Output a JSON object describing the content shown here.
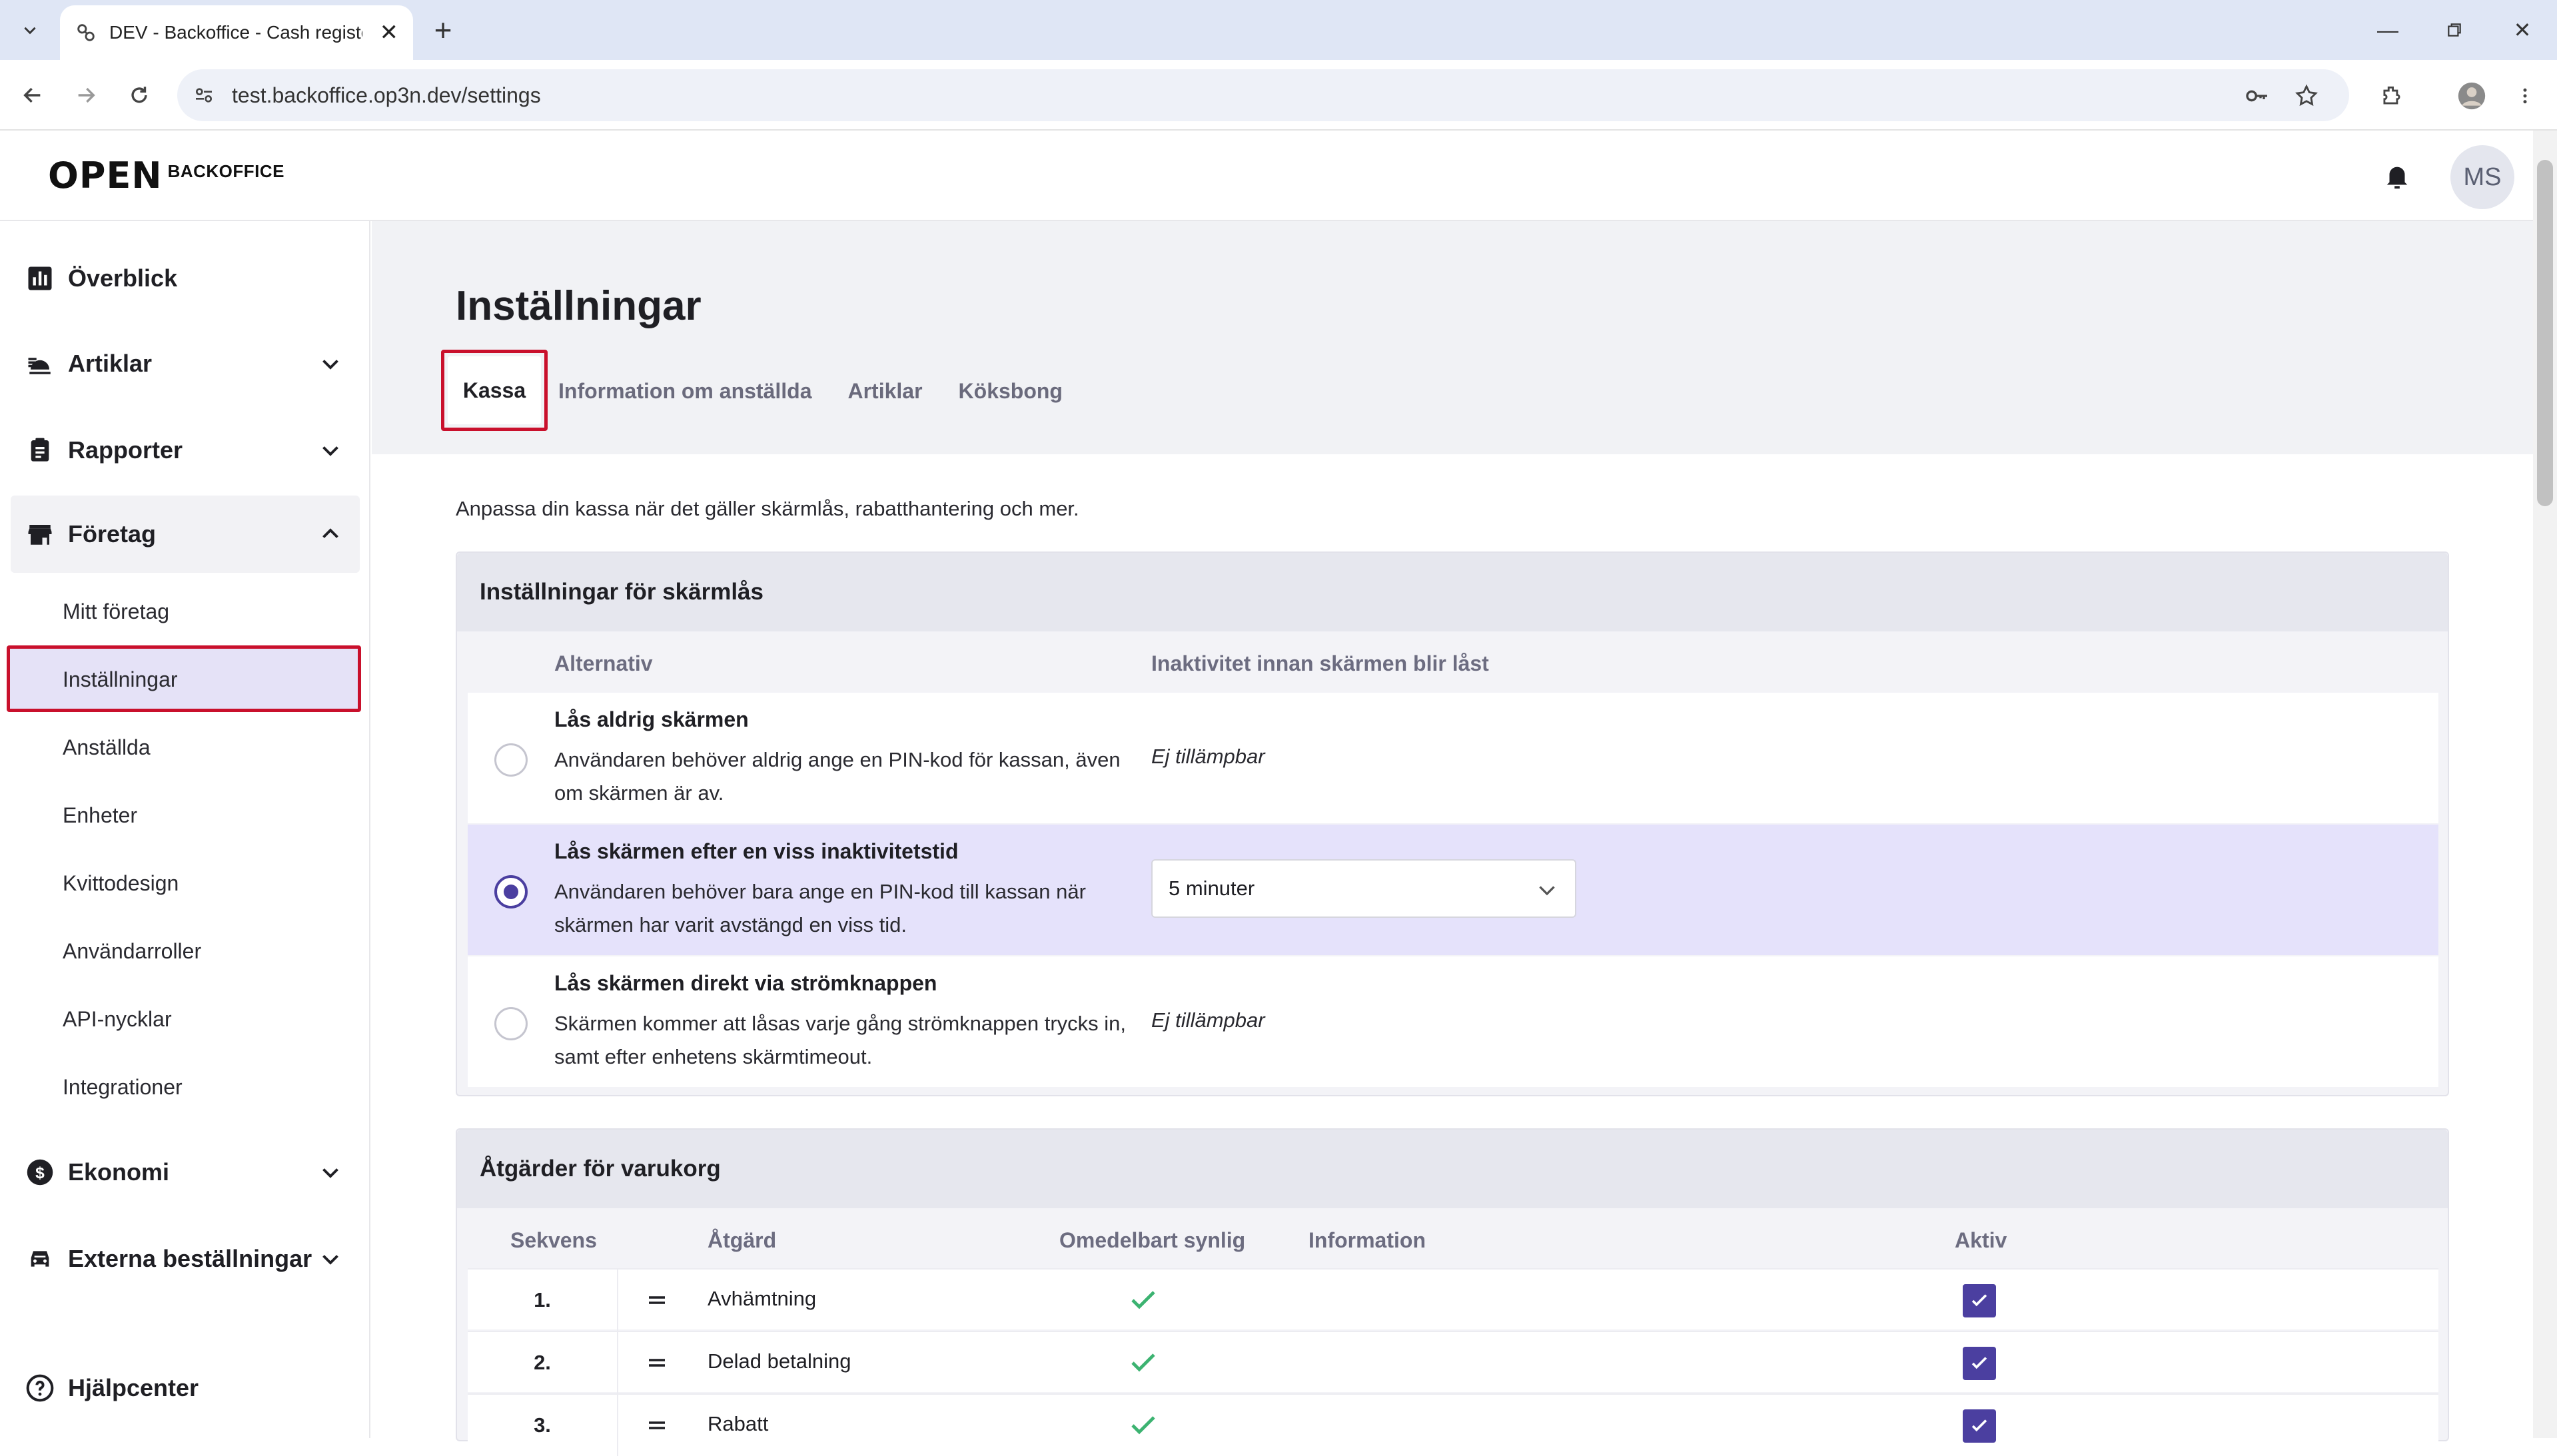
{
  "browser": {
    "tab_title": "DEV - Backoffice - Cash register",
    "url": "test.backoffice.op3n.dev/settings"
  },
  "app": {
    "logo_mark": "OPEN",
    "logo_text": "BACKOFFICE",
    "avatar_initials": "MS"
  },
  "sidebar": {
    "items": [
      {
        "label": "Överblick",
        "icon": "bar-chart-icon"
      },
      {
        "label": "Artiklar",
        "icon": "food-icon"
      },
      {
        "label": "Rapporter",
        "icon": "clipboard-icon"
      },
      {
        "label": "Företag",
        "icon": "store-icon"
      },
      {
        "label": "Ekonomi",
        "icon": "dollar-icon"
      },
      {
        "label": "Externa beställningar",
        "icon": "car-icon"
      },
      {
        "label": "Hjälpcenter",
        "icon": "help-icon"
      }
    ],
    "company_sub": [
      "Mitt företag",
      "Inställningar",
      "Anställda",
      "Enheter",
      "Kvittodesign",
      "Användarroller",
      "API-nycklar",
      "Integrationer"
    ],
    "active_sub": "Inställningar"
  },
  "page": {
    "title": "Inställningar",
    "tabs": [
      "Kassa",
      "Information om anställda",
      "Artiklar",
      "Köksbong"
    ],
    "active_tab": "Kassa",
    "intro": "Anpassa din kassa när det gäller skärmlås, rabatthantering och mer."
  },
  "screen_lock": {
    "heading": "Inställningar för skärmlås",
    "col_option": "Alternativ",
    "col_inactivity": "Inaktivitet innan skärmen blir låst",
    "options": [
      {
        "title": "Lås aldrig skärmen",
        "desc": "Användaren behöver aldrig ange en PIN-kod för kassan, även om skärmen är av.",
        "value": "Ej tillämpbar"
      },
      {
        "title": "Lås skärmen efter en viss inaktivitetstid",
        "desc": "Användaren behöver bara ange en PIN-kod till kassan när skärmen har varit avstängd en viss tid.",
        "value": "5 minuter"
      },
      {
        "title": "Lås skärmen direkt via strömknappen",
        "desc": "Skärmen kommer att låsas varje gång strömknappen trycks in, samt efter enhetens skärmtimeout.",
        "value": "Ej tillämpbar"
      }
    ],
    "selected_index": 1
  },
  "cart_actions": {
    "heading": "Åtgärder för varukorg",
    "columns": [
      "Sekvens",
      "Åtgärd",
      "Omedelbart synlig",
      "Information",
      "Aktiv"
    ],
    "rows": [
      {
        "seq": "1.",
        "action": "Avhämtning",
        "visible": true,
        "active": true
      },
      {
        "seq": "2.",
        "action": "Delad betalning",
        "visible": true,
        "active": true
      },
      {
        "seq": "3.",
        "action": "Rabatt",
        "visible": true,
        "active": true
      }
    ]
  },
  "colors": {
    "accent": "#4b3fa0",
    "highlight": "#c9102c",
    "selected_row": "#e5e2fb",
    "check": "#3cb371"
  }
}
